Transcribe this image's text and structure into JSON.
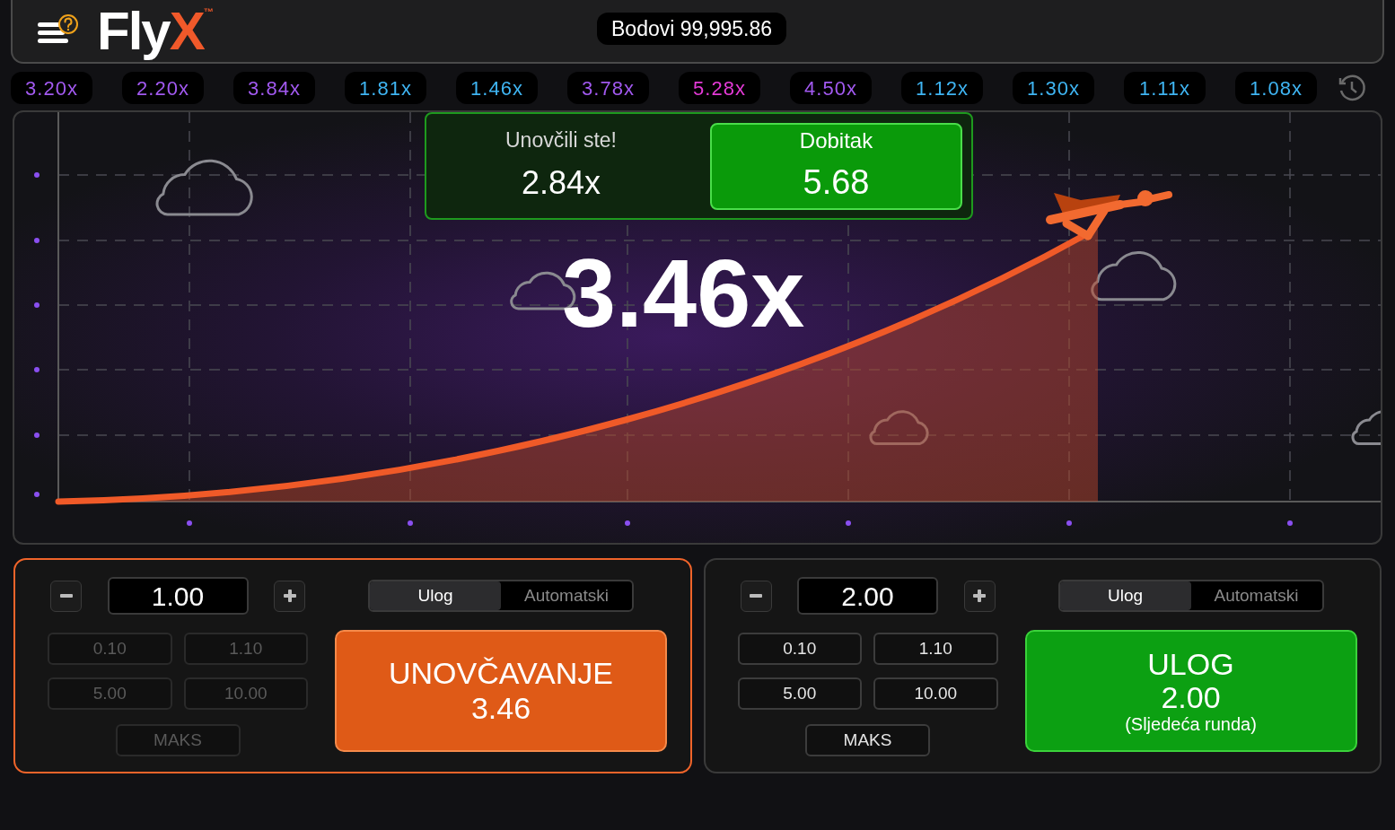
{
  "header": {
    "logo": {
      "text": "Fly",
      "accent": "X",
      "mark": "™"
    },
    "balance": "Bodovi 99,995.86"
  },
  "history": [
    {
      "value": "3.20x",
      "color": "#a259f0"
    },
    {
      "value": "2.20x",
      "color": "#a259f0"
    },
    {
      "value": "3.84x",
      "color": "#a259f0"
    },
    {
      "value": "1.81x",
      "color": "#3fb5f3"
    },
    {
      "value": "1.46x",
      "color": "#3fb5f3"
    },
    {
      "value": "3.78x",
      "color": "#a259f0"
    },
    {
      "value": "5.28x",
      "color": "#e53ad8"
    },
    {
      "value": "4.50x",
      "color": "#a259f0"
    },
    {
      "value": "1.12x",
      "color": "#3fb5f3"
    },
    {
      "value": "1.30x",
      "color": "#3fb5f3"
    },
    {
      "value": "1.11x",
      "color": "#3fb5f3"
    },
    {
      "value": "1.08x",
      "color": "#3fb5f3"
    }
  ],
  "game": {
    "multiplier": "3.46x",
    "win_popup": {
      "title": "Unovčili ste!",
      "multiplier": "2.84x",
      "win_label": "Dobitak",
      "win_amount": "5.68"
    }
  },
  "bet_panels": [
    {
      "active": true,
      "amount": "1.00",
      "tabs": [
        {
          "label": "Ulog",
          "selected": true
        },
        {
          "label": "Automatski",
          "selected": false
        }
      ],
      "presets": [
        {
          "label": "0.10",
          "disabled": true
        },
        {
          "label": "1.10",
          "disabled": true
        },
        {
          "label": "5.00",
          "disabled": true
        },
        {
          "label": "10.00",
          "disabled": true
        }
      ],
      "max_button": {
        "label": "MAKS",
        "disabled": true
      },
      "action": {
        "kind": "cashout",
        "title": "UNOVČAVANJE",
        "amount": "3.46"
      }
    },
    {
      "active": false,
      "amount": "2.00",
      "tabs": [
        {
          "label": "Ulog",
          "selected": true
        },
        {
          "label": "Automatski",
          "selected": false
        }
      ],
      "presets": [
        {
          "label": "0.10",
          "disabled": false
        },
        {
          "label": "1.10",
          "disabled": false
        },
        {
          "label": "5.00",
          "disabled": false
        },
        {
          "label": "10.00",
          "disabled": false
        }
      ],
      "max_button": {
        "label": "MAKS",
        "disabled": false
      },
      "action": {
        "kind": "bet",
        "title": "ULOG",
        "amount": "2.00",
        "note": "(Sljedeća runda)"
      }
    }
  ]
}
